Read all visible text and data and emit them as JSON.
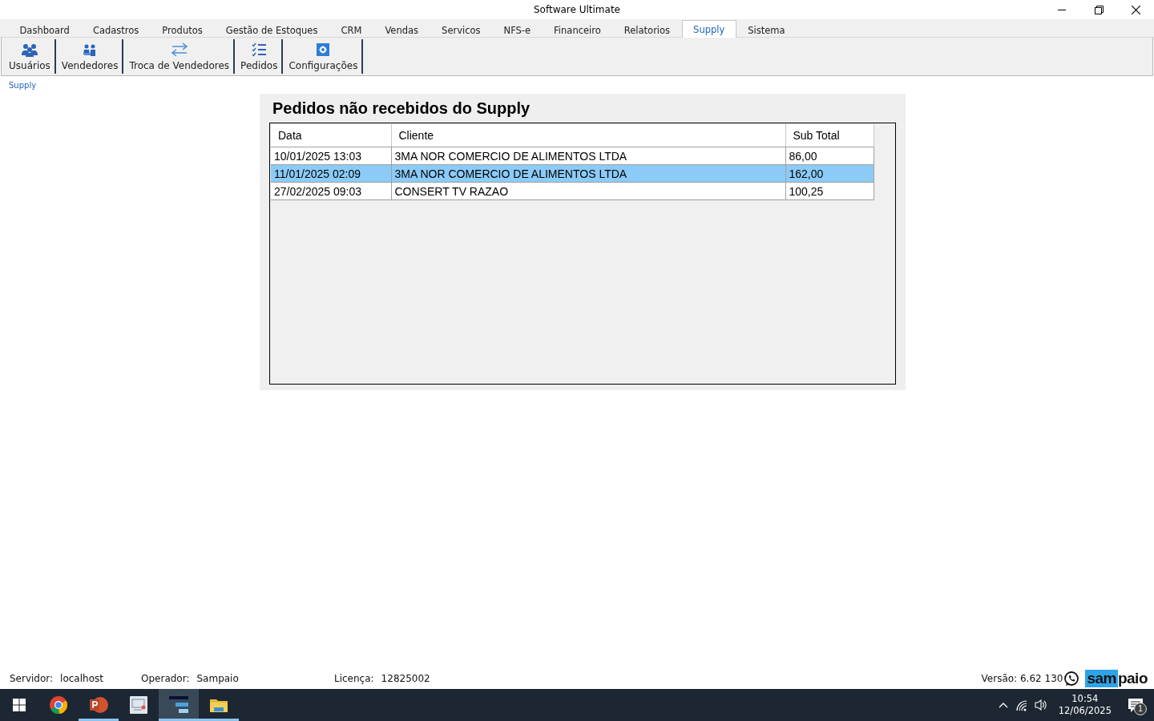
{
  "window": {
    "title": "Software Ultimate"
  },
  "tabs": [
    {
      "label": "Dashboard",
      "selected": false
    },
    {
      "label": "Cadastros",
      "selected": false
    },
    {
      "label": "Produtos",
      "selected": false
    },
    {
      "label": "Gestão de Estoques",
      "selected": false
    },
    {
      "label": "CRM",
      "selected": false
    },
    {
      "label": "Vendas",
      "selected": false
    },
    {
      "label": "Servicos",
      "selected": false
    },
    {
      "label": "NFS-e",
      "selected": false
    },
    {
      "label": "Financeiro",
      "selected": false
    },
    {
      "label": "Relatorios",
      "selected": false
    },
    {
      "label": "Supply",
      "selected": true
    },
    {
      "label": "Sistema",
      "selected": false
    }
  ],
  "toolbar": [
    {
      "label": "Usuários",
      "kind": "users"
    },
    {
      "label": "Vendedores",
      "kind": "sellers"
    },
    {
      "label": "Troca de Vendedores",
      "kind": "swap"
    },
    {
      "label": "Pedidos",
      "kind": "list"
    },
    {
      "label": "Configurações",
      "kind": "gear"
    }
  ],
  "breadcrumb": "Supply",
  "panel": {
    "title": "Pedidos não recebidos do Supply",
    "table": {
      "columns": [
        "Data",
        "Cliente",
        "Sub Total"
      ],
      "rows": [
        {
          "cells": [
            "10/01/2025 13:03",
            "3MA NOR COMERCIO DE ALIMENTOS LTDA",
            "86,00"
          ],
          "selected": false
        },
        {
          "cells": [
            "11/01/2025 02:09",
            "3MA NOR COMERCIO DE ALIMENTOS LTDA",
            "162,00"
          ],
          "selected": true
        },
        {
          "cells": [
            "27/02/2025 09:03",
            "CONSERT TV RAZAO",
            "100,25"
          ],
          "selected": false
        }
      ]
    }
  },
  "status_bar": {
    "fields": [
      {
        "label": "Servidor:",
        "value": "localhost"
      },
      {
        "label": "Operador:",
        "value": "Sampaio"
      },
      {
        "label": "Licença:",
        "value": "12825002"
      }
    ],
    "version": "Versão: 6.62 130",
    "logo": {
      "highlighted": "sam",
      "rest": "paio"
    }
  },
  "taskbar": {
    "apps": [
      {
        "kind": "chrome",
        "running": false,
        "selected": false
      },
      {
        "kind": "powerpoint",
        "running": true,
        "selected": false
      },
      {
        "kind": "remote",
        "running": false,
        "selected": false
      },
      {
        "kind": "app",
        "running": true,
        "selected": true
      },
      {
        "kind": "folder",
        "running": true,
        "selected": false
      }
    ],
    "time": "10:54",
    "date": "12/06/2025",
    "notifications": "1"
  }
}
